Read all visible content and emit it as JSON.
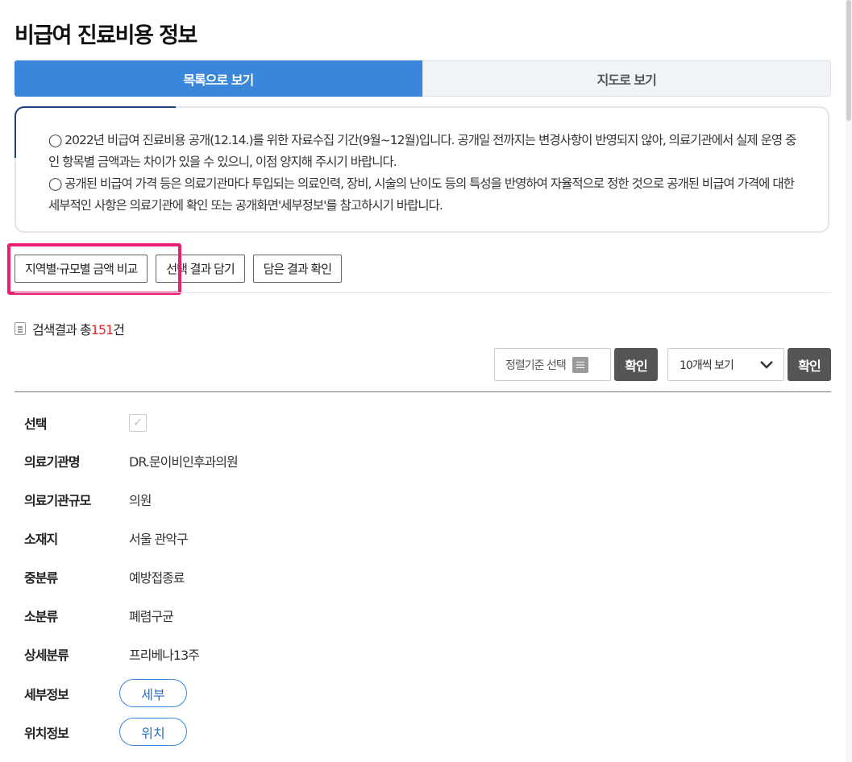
{
  "page": {
    "title": "비급여 진료비용 정보"
  },
  "tabs": [
    {
      "label": "목록으로 보기",
      "active": true
    },
    {
      "label": "지도로 보기",
      "active": false
    }
  ],
  "notice": {
    "paragraphs": [
      "◯ 2022년 비급여 진료비용 공개(12.14.)를 위한 자료수집 기간(9월~12월)입니다. 공개일 전까지는 변경사항이 반영되지 않아, 의료기관에서 실제 운영 중인 항목별 금액과는 차이가 있을 수 있으니, 이점 양지해 주시기 바랍니다.",
      "◯ 공개된 비급여 가격 등은 의료기관마다 투입되는 의료인력, 장비, 시술의 난이도 등의 특성을 반영하여 자율적으로 정한 것으로 공개된 비급여 가격에 대한 세부적인 사항은 의료기관에 확인 또는 공개화면'세부정보'를 참고하시기 바랍니다."
    ]
  },
  "actions": {
    "compare_label": "지역별·규모별 금액 비교",
    "add_label": "선택 결과 담기",
    "check_label": "담은 결과 확인"
  },
  "results": {
    "prefix": "검색결과 총",
    "count": "151",
    "suffix": "건"
  },
  "controls": {
    "sort_label": "정렬기준 선택",
    "sort_confirm": "확인",
    "page_size_label": "10개씩 보기",
    "page_confirm": "확인"
  },
  "detail": {
    "select_label": "선택",
    "rows": [
      {
        "label": "의료기관명",
        "value": "DR.문이비인후과의원"
      },
      {
        "label": "의료기관규모",
        "value": "의원"
      },
      {
        "label": "소재지",
        "value": "서울 관악구"
      },
      {
        "label": "중분류",
        "value": "예방접종료"
      },
      {
        "label": "소분류",
        "value": "폐렴구균"
      },
      {
        "label": "상세분류",
        "value": "프리베나13주"
      }
    ],
    "detail_info_label": "세부정보",
    "detail_info_button": "세부",
    "location_label": "위치정보",
    "location_button": "위치"
  },
  "colors": {
    "primary": "#3a86db",
    "highlight": "#ea1f73",
    "count": "#e0262c"
  }
}
